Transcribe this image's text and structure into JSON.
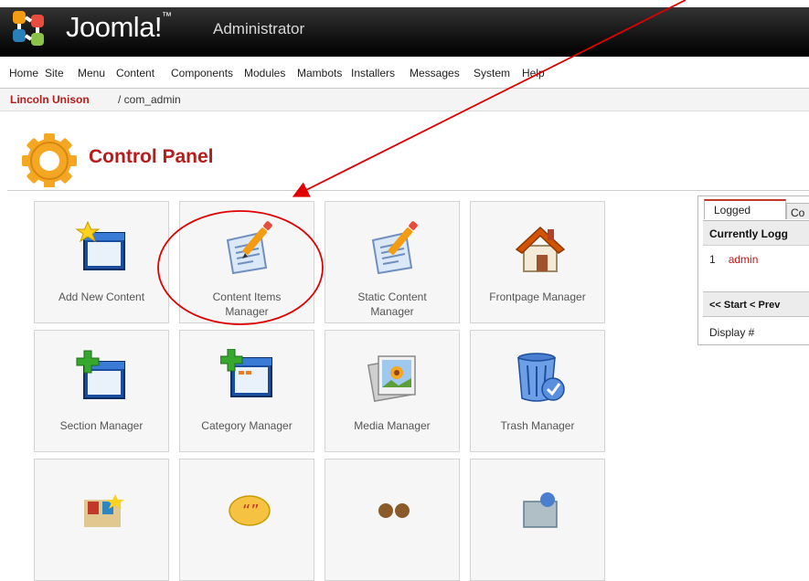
{
  "app": {
    "brand": "Joomla!",
    "trademark": "™",
    "subtitle": "Administrator"
  },
  "menu": {
    "items": [
      "Home",
      "Site",
      "Menu",
      "Content",
      "Components",
      "Modules",
      "Mambots",
      "Installers",
      "Messages",
      "System",
      "Help"
    ]
  },
  "pathway": {
    "site": "Lincoln Unison",
    "rest": "/ com_admin"
  },
  "page": {
    "title": "Control Panel"
  },
  "tiles": {
    "add_content": {
      "line1": "Add New Content",
      "line2": ""
    },
    "content_items": {
      "line1": "Content Items",
      "line2": "Manager"
    },
    "static_content": {
      "line1": "Static Content",
      "line2": "Manager"
    },
    "frontpage": {
      "line1": "Frontpage Manager",
      "line2": ""
    },
    "section": {
      "line1": "Section Manager",
      "line2": ""
    },
    "category": {
      "line1": "Category Manager",
      "line2": ""
    },
    "media": {
      "line1": "Media Manager",
      "line2": ""
    },
    "trash": {
      "line1": "Trash Manager",
      "line2": ""
    }
  },
  "side_panel": {
    "tab_active": "Logged",
    "tab_next": "Co",
    "heading": "Currently Logg",
    "row_number": "1",
    "row_user": "admin",
    "pager": "<< Start < Prev",
    "display_label": "Display #"
  },
  "colors": {
    "accent_red": "#b71c1c",
    "annotation_red": "#e00000"
  }
}
